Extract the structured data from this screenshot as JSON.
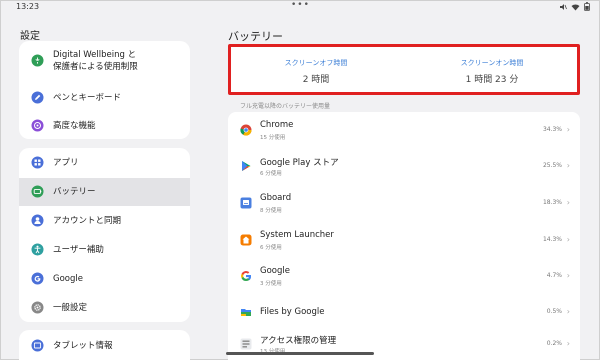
{
  "status_bar": {
    "time": "13:23",
    "center_dots": "•••",
    "icons": [
      "mute-icon",
      "wifi-icon",
      "battery-icon"
    ]
  },
  "settings": {
    "title": "設定",
    "groups": [
      {
        "items": [
          {
            "label": "Digital Wellbeing と\n保護者による使用制限",
            "icon": "wellbeing-icon",
            "color": "#2f9e57"
          },
          {
            "label": "ペンとキーボード",
            "icon": "pen-icon",
            "color": "#4a6fd8"
          },
          {
            "label": "高度な機能",
            "icon": "advanced-features-icon",
            "color": "#8b4fd8"
          }
        ]
      },
      {
        "items": [
          {
            "label": "アプリ",
            "icon": "apps-icon",
            "color": "#4a6fd8"
          },
          {
            "label": "バッテリー",
            "icon": "battery-icon",
            "color": "#2f9e57",
            "selected": true
          },
          {
            "label": "アカウントと同期",
            "icon": "account-icon",
            "color": "#4a6fd8"
          },
          {
            "label": "ユーザー補助",
            "icon": "accessibility-icon",
            "color": "#2fa0a0"
          },
          {
            "label": "Google",
            "icon": "google-icon",
            "color": "#4a6fd8"
          },
          {
            "label": "一般設定",
            "icon": "gear-icon",
            "color": "#888888"
          }
        ]
      },
      {
        "items": [
          {
            "label": "タブレット情報",
            "icon": "tablet-icon",
            "color": "#4a6fd8"
          }
        ]
      }
    ]
  },
  "battery": {
    "title": "バッテリー",
    "screen_off_label": "スクリーンオフ時間",
    "screen_off_value": "2 時間",
    "screen_on_label": "スクリーンオン時間",
    "screen_on_value": "1 時間 23 分",
    "highlight_color": "#e02020",
    "section_label": "フル充電以降のバッテリー使用量",
    "apps": [
      {
        "name": "Chrome",
        "sub": "15 分使用",
        "pct": "34.3%",
        "icon": "chrome-icon"
      },
      {
        "name": "Google Play ストア",
        "sub": "6 分使用",
        "pct": "25.5%",
        "icon": "play-store-icon"
      },
      {
        "name": "Gboard",
        "sub": "8 分使用",
        "pct": "18.3%",
        "icon": "gboard-icon"
      },
      {
        "name": "System Launcher",
        "sub": "6 分使用",
        "pct": "14.3%",
        "icon": "launcher-icon"
      },
      {
        "name": "Google",
        "sub": "3 分使用",
        "pct": "4.7%",
        "icon": "google-icon"
      },
      {
        "name": "Files by Google",
        "sub": "",
        "pct": "0.5%",
        "icon": "files-icon"
      },
      {
        "name": "アクセス権限の管理",
        "sub": "13 分使用",
        "pct": "0.2%",
        "icon": "permission-icon"
      }
    ],
    "chevron": "›"
  },
  "colors": {
    "accent": "#3d7fd6",
    "background": "#f1f1f3",
    "card": "#ffffff",
    "selected": "#e3e3e6"
  }
}
